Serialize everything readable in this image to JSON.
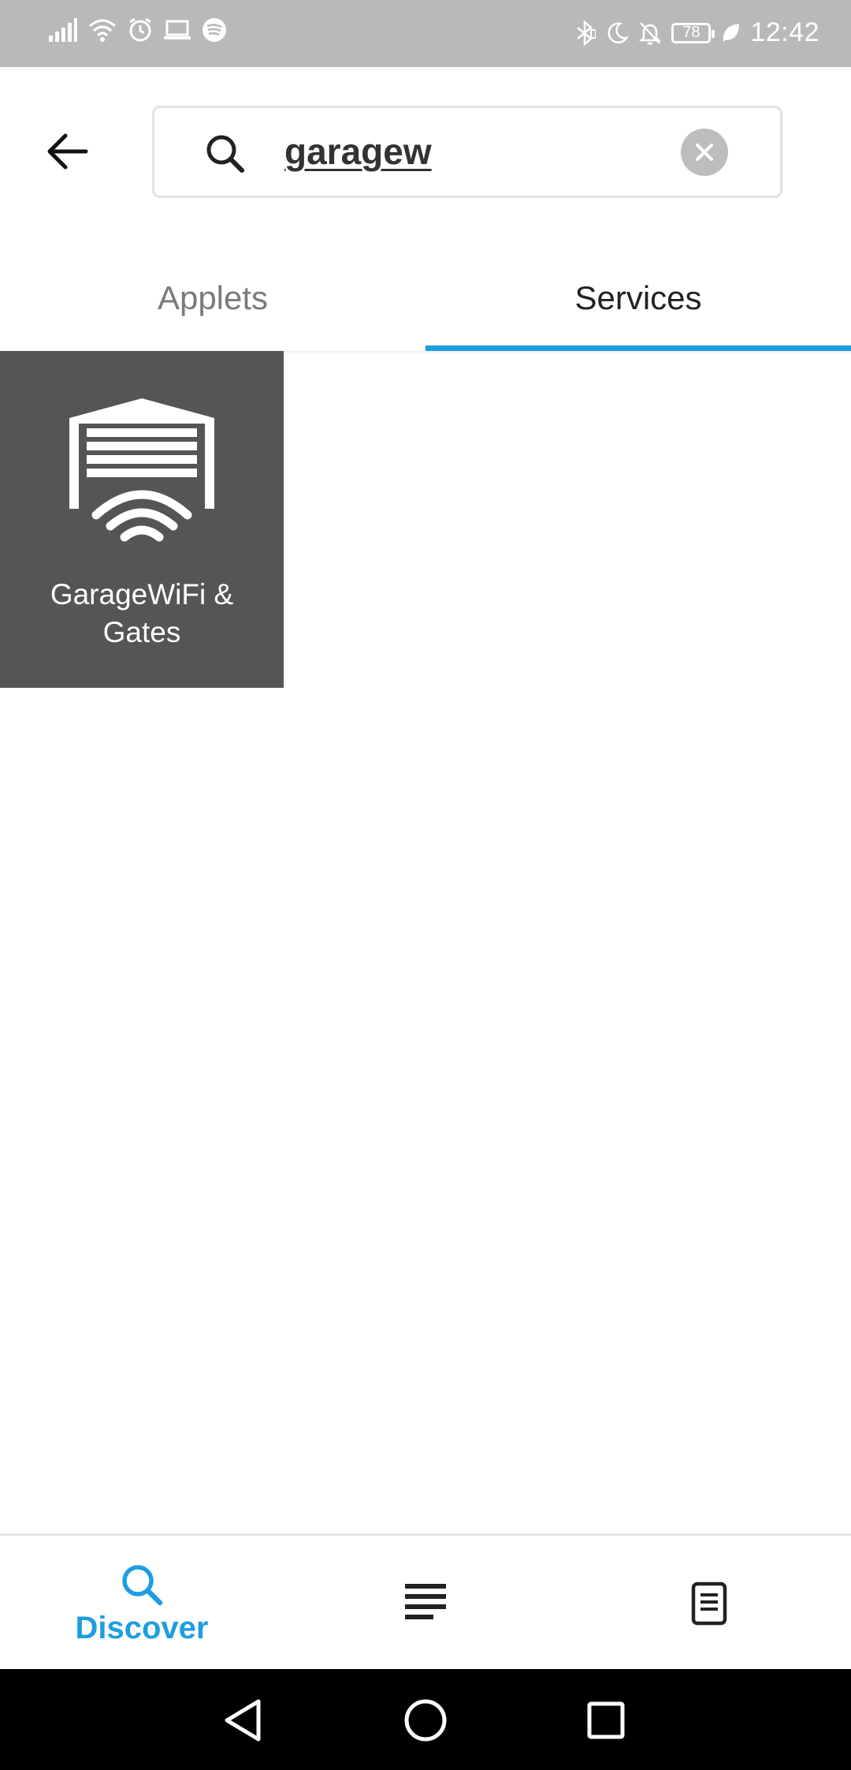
{
  "status_bar": {
    "time": "12:42",
    "battery": "78",
    "left_icons": [
      "signal-icon",
      "wifi-icon",
      "alarm-icon",
      "laptop-icon",
      "spotify-icon"
    ],
    "right_icons": [
      "bluetooth-icon",
      "moon-icon",
      "bell-off-icon",
      "battery-icon",
      "leaf-icon"
    ]
  },
  "header": {
    "back_icon": "arrow-left-icon",
    "search": {
      "value": "garagew",
      "icon": "search-icon",
      "clear_icon": "close-icon"
    }
  },
  "tabs": [
    {
      "label": "Applets",
      "active": false
    },
    {
      "label": "Services",
      "active": true
    }
  ],
  "results": [
    {
      "name": "GarageWiFi & Gates",
      "line1": "GarageWiFi &",
      "line2": "Gates",
      "icon": "garage-wifi-icon",
      "bg_color": "#555555"
    }
  ],
  "bottom_nav": {
    "discover_label": "Discover",
    "items": [
      "search-icon",
      "feed-icon",
      "activity-icon"
    ],
    "accent": "#1f9de1"
  },
  "system_nav": [
    "back-triangle-icon",
    "home-circle-icon",
    "recents-square-icon"
  ]
}
